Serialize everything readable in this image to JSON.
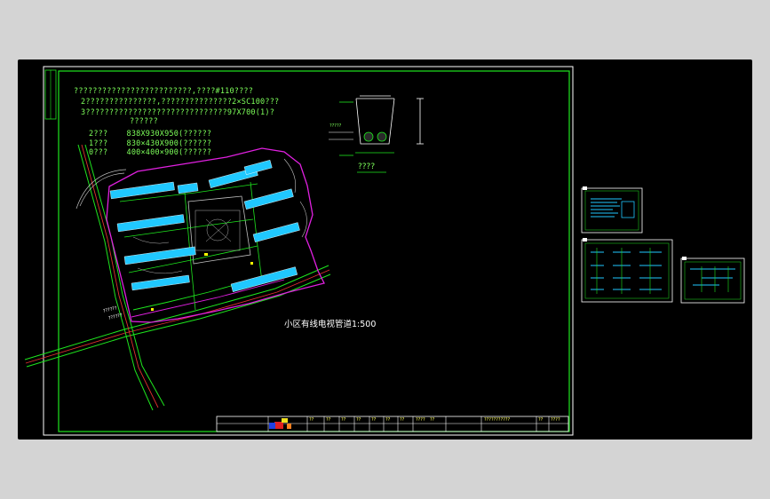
{
  "notes": {
    "line1": "?????????????????????????,????#110????",
    "line2": "2???????????????,???????????????2×SC100???",
    "line3": "3??????????????????????????????97X700(1)?",
    "line4": "??????",
    "spec1": "2???    838X930X950(??????",
    "spec2": "1???    830×430X900(??????",
    "spec3": "0???    400×400×900(??????"
  },
  "plan": {
    "title": "小区有线电视管道1:500",
    "road_label_a": "??????",
    "road_label_b": "??????"
  },
  "detail": {
    "caption": "????",
    "label_left": "?????"
  },
  "title_block": {
    "cells": [
      "??",
      "??",
      "??",
      "??",
      "??",
      "??",
      "??",
      "????",
      "??",
      "??"
    ],
    "project": "???????????",
    "sheet_no": "????"
  },
  "colors": {
    "frame": "#1ee61e",
    "boundary": "#e020e0",
    "road": "#e03030",
    "buildings": "#20c8ff",
    "background": "#000000",
    "border": "#d4d4d4"
  }
}
